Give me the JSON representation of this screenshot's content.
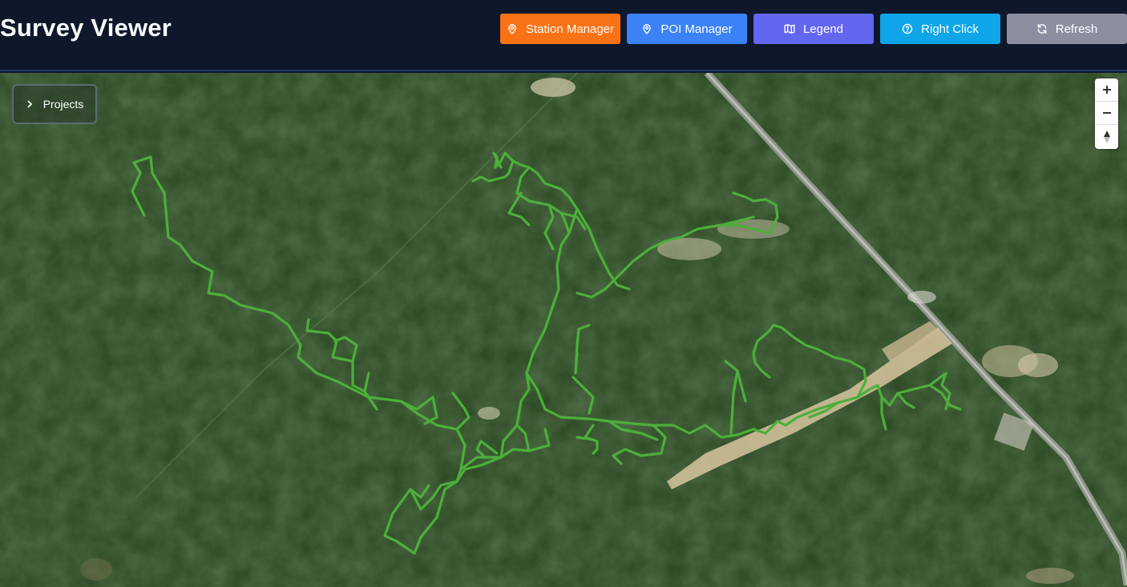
{
  "header": {
    "title": "Survey Viewer",
    "buttons": {
      "station_manager": "Station Manager",
      "poi_manager": "POI Manager",
      "legend": "Legend",
      "right_click": "Right Click",
      "refresh": "Refresh"
    }
  },
  "colors": {
    "station_manager": "#f97316",
    "poi_manager": "#3b82f6",
    "legend": "#6366f1",
    "right_click": "#0ea5e9",
    "refresh": "#8b8f9f",
    "survey_line": "#4caf3a"
  },
  "map": {
    "projects_label": "Projects",
    "basemap": "satellite",
    "controls": [
      "zoom-in",
      "zoom-out",
      "reset-north"
    ]
  }
}
